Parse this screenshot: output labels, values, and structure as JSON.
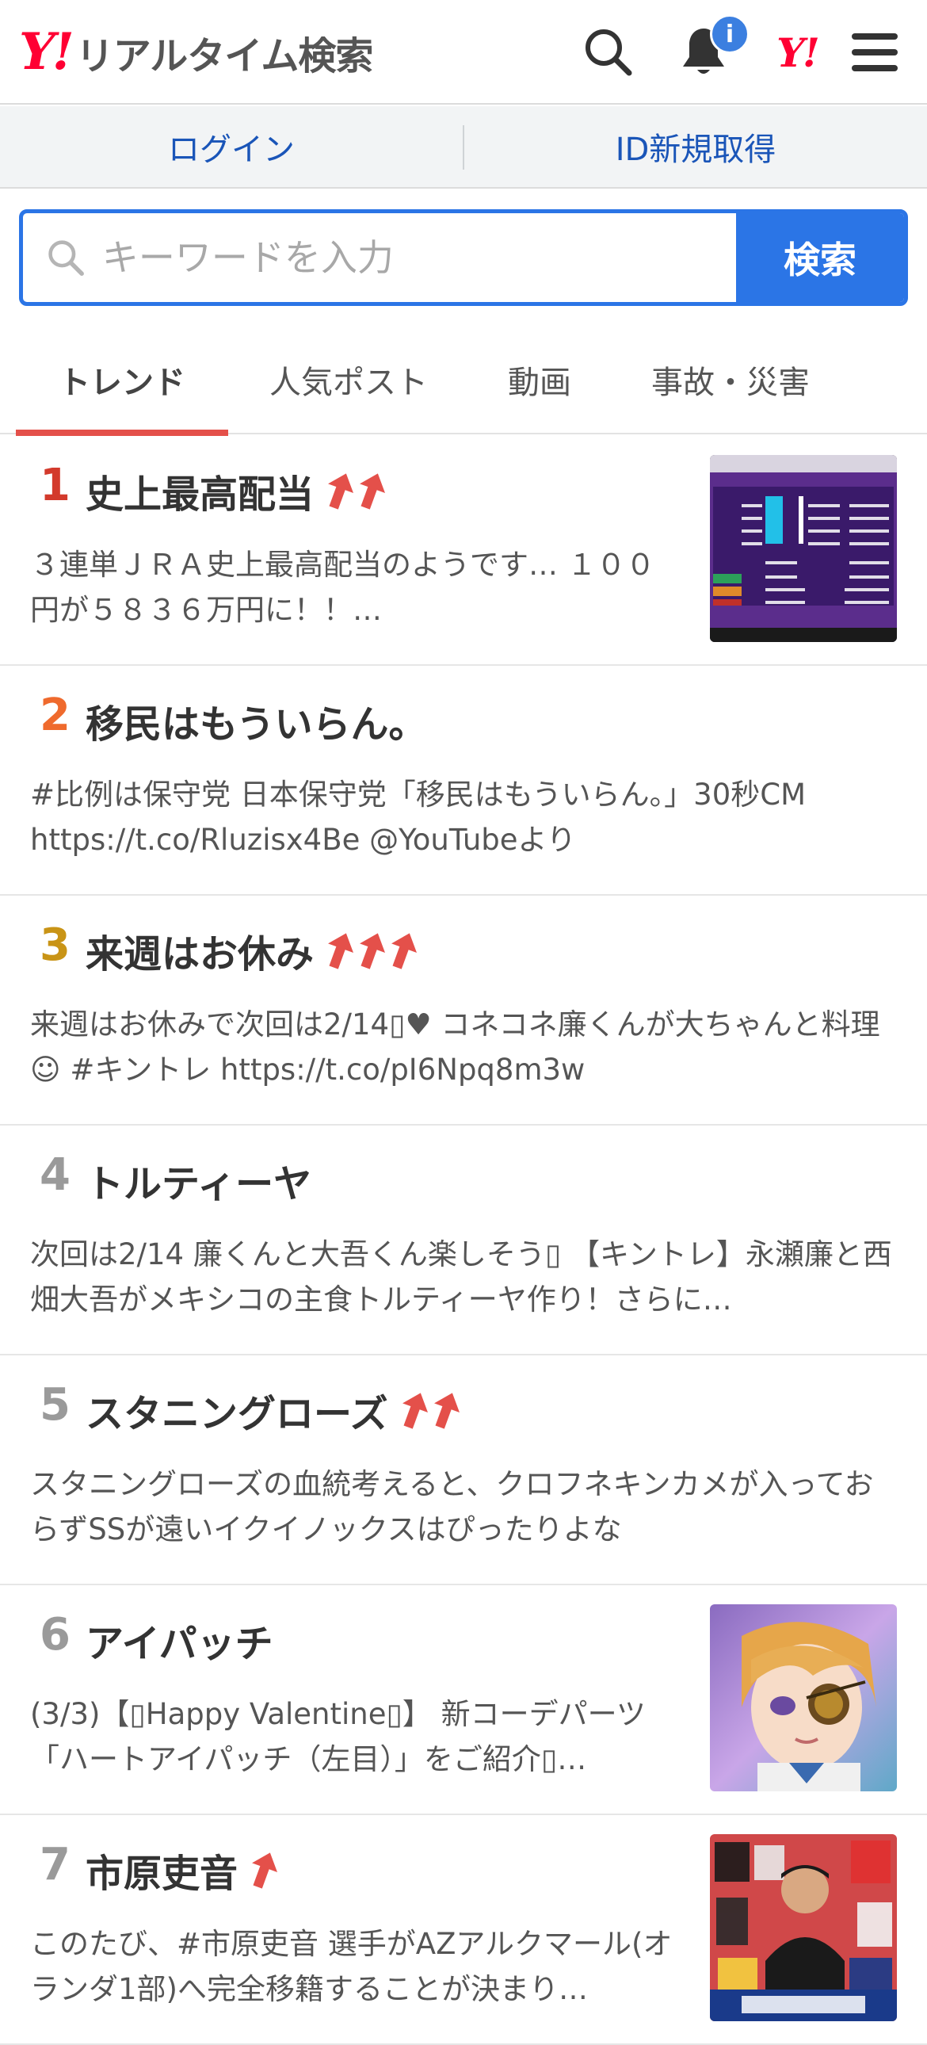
{
  "header": {
    "logo_mark": "Y!",
    "logo_text": "リアルタイム検索",
    "badge": "i",
    "yahoo_short": "Y!"
  },
  "loginbar": {
    "login": "ログイン",
    "signup": "ID新規取得"
  },
  "search": {
    "placeholder": "キーワードを入力",
    "button": "検索"
  },
  "tabs": [
    {
      "label": "トレンド",
      "active": true
    },
    {
      "label": "人気ポスト"
    },
    {
      "label": "動画"
    },
    {
      "label": "事故・災害"
    }
  ],
  "colors": {
    "accent": "#2b75e6",
    "rank1": "#d33a2c",
    "rank2": "#ef6a2d",
    "rank3": "#c99416",
    "rank_other": "#9a9a9a",
    "arrow": "#e4504a",
    "tab_indicator": "#e4504a"
  },
  "trends": [
    {
      "rank": "1",
      "title": "史上最高配当",
      "arrows": 2,
      "desc": "３連単ＪＲＡ史上最高配当のようです… １００円が５８３６万円に！！…",
      "thumb": "odds-board"
    },
    {
      "rank": "2",
      "title": "移民はもういらん。",
      "arrows": 0,
      "desc": "#比例は保守党 日本保守党「移民はもういらん。」30秒CM https://t.co/Rluzisx4Be @YouTubeより",
      "thumb": null
    },
    {
      "rank": "3",
      "title": "来週はお休み",
      "arrows": 3,
      "desc": "来週はお休みで次回は2/14▯♥ コネコネ廉くんが大ちゃんと料理☺ #キントレ https://t.co/pI6Npq8m3w",
      "thumb": null
    },
    {
      "rank": "4",
      "title": "トルティーヤ",
      "arrows": 0,
      "desc": "次回は2/14 廉くんと大吾くん楽しそう▯ 【キントレ】永瀬廉と西畑大吾がメキシコの主食トルティーヤ作り！さらに…",
      "thumb": null
    },
    {
      "rank": "5",
      "title": "スタニングローズ",
      "arrows": 2,
      "desc": "スタニングローズの血統考えると、クロフネキンカメが入っておらずSSが遠いイクイノックスはぴったりよな",
      "thumb": null
    },
    {
      "rank": "6",
      "title": "アイパッチ",
      "arrows": 0,
      "desc": "(3/3)【▯Happy Valentine▯】 新コーデパーツ「ハートアイパッチ（左目）」をご紹介▯…",
      "thumb": "anime-character"
    },
    {
      "rank": "7",
      "title": "市原吏音",
      "arrows": 1,
      "desc": "このたび、#市原吏音 選手がAZアルクマール(オランダ1部)へ完全移籍することが決まり…",
      "thumb": "soccer-poster"
    }
  ]
}
